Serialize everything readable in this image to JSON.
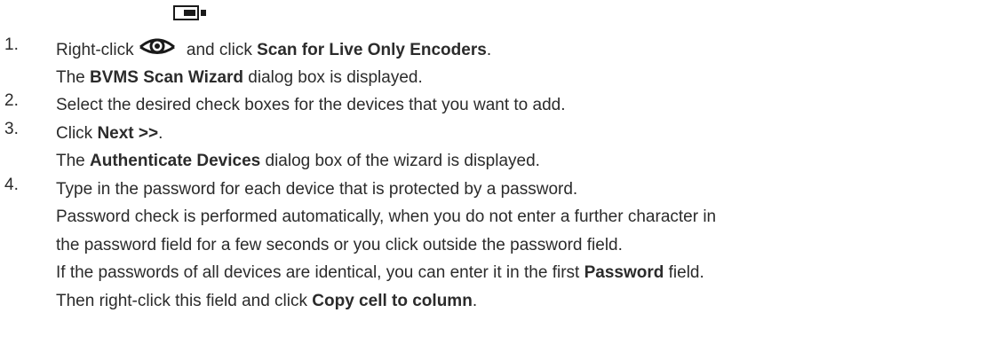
{
  "icons": {
    "device": "encoder-device-icon",
    "eye": "live-eye-icon"
  },
  "steps": [
    {
      "number": "1.",
      "lines": [
        [
          {
            "text": "Right-click ",
            "bold": false
          },
          {
            "icon": "eye"
          },
          {
            "text": "and click ",
            "bold": false
          },
          {
            "text": "Scan for Live Only Encoders",
            "bold": true
          },
          {
            "text": ".",
            "bold": false
          }
        ],
        [
          {
            "text": "The ",
            "bold": false
          },
          {
            "text": "BVMS Scan Wizard",
            "bold": true
          },
          {
            "text": " dialog box is displayed.",
            "bold": false
          }
        ]
      ]
    },
    {
      "number": "2.",
      "lines": [
        [
          {
            "text": "Select the desired check boxes for the devices that you want to add.",
            "bold": false
          }
        ]
      ]
    },
    {
      "number": "3.",
      "lines": [
        [
          {
            "text": "Click ",
            "bold": false
          },
          {
            "text": "Next >>",
            "bold": true
          },
          {
            "text": ".",
            "bold": false
          }
        ],
        [
          {
            "text": "The ",
            "bold": false
          },
          {
            "text": "Authenticate Devices",
            "bold": true
          },
          {
            "text": " dialog box of the wizard is displayed.",
            "bold": false
          }
        ]
      ]
    },
    {
      "number": "4.",
      "lines": [
        [
          {
            "text": "Type in the password for each device that is protected by a password.",
            "bold": false
          }
        ],
        [
          {
            "text": "Password check is performed automatically, when you do not enter a further character in",
            "bold": false
          }
        ],
        [
          {
            "text": "the password field for a few seconds or you click outside the password field.",
            "bold": false
          }
        ],
        [
          {
            "text": "If the passwords of all devices are identical, you can enter it in the first ",
            "bold": false
          },
          {
            "text": "Password",
            "bold": true
          },
          {
            "text": " field.",
            "bold": false
          }
        ],
        [
          {
            "text": "Then right-click this field and click ",
            "bold": false
          },
          {
            "text": "Copy cell to column",
            "bold": true
          },
          {
            "text": ".",
            "bold": false
          }
        ]
      ]
    }
  ]
}
